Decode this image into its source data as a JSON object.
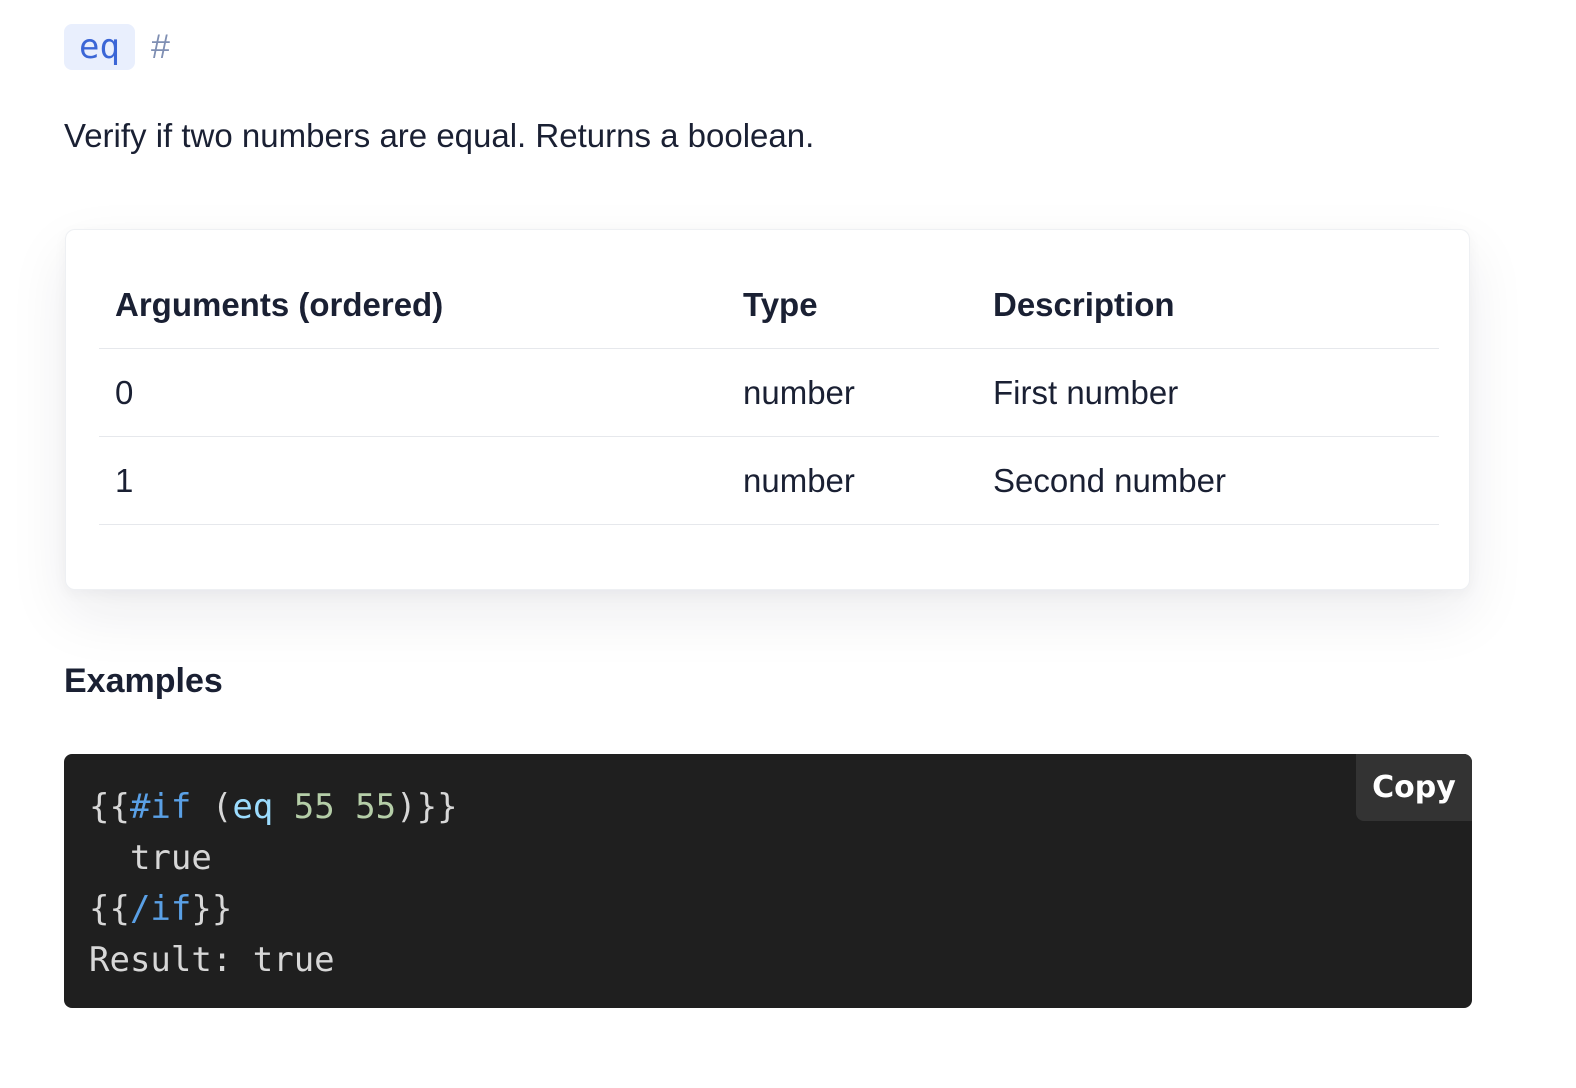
{
  "heading": {
    "function_name": "eq",
    "anchor": "#"
  },
  "description": "Verify if two numbers are equal. Returns a boolean.",
  "arguments_table": {
    "headers": [
      "Arguments (ordered)",
      "Type",
      "Description"
    ],
    "rows": [
      [
        "0",
        "number",
        "First number"
      ],
      [
        "1",
        "number",
        "Second number"
      ]
    ]
  },
  "examples": {
    "title": "Examples",
    "copy_label": "Copy",
    "code": {
      "open_braces": "{{",
      "if_keyword": "#if",
      "paren_open": " (",
      "helper": "eq",
      "arg1": " 55",
      "arg2": " 55",
      "paren_close_braces": ")}}",
      "line2": "  true",
      "close_open_braces": "{{",
      "endif_keyword": "/if",
      "close_braces": "}}",
      "line4": "Result: true"
    },
    "colors": {
      "background": "#1f1f1f",
      "keyword": "#5aa0e6",
      "helper": "#9cdcfe",
      "number": "#b5cea8",
      "text": "#d7d7d7"
    }
  }
}
